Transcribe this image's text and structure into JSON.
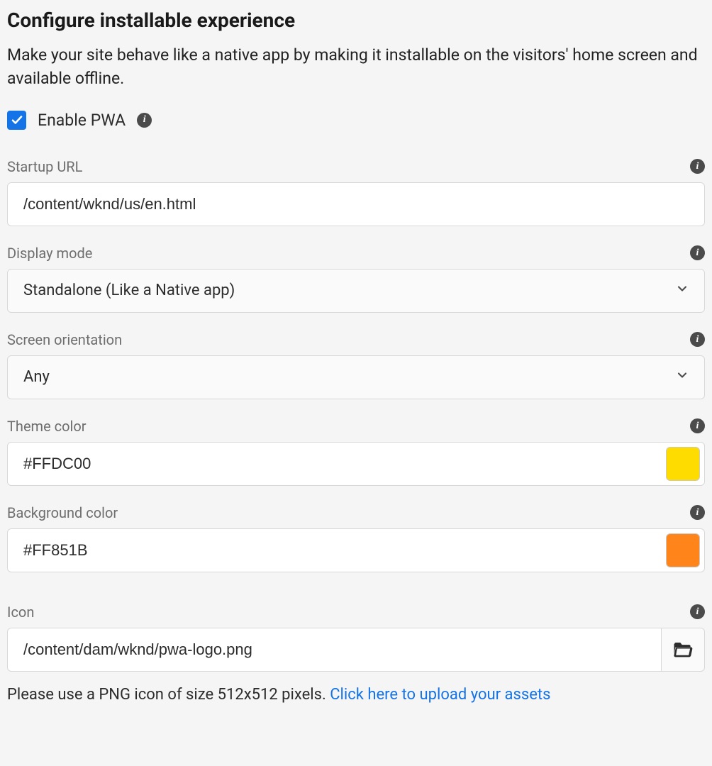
{
  "header": {
    "title": "Configure installable experience",
    "description": "Make your site behave like a native app by making it installable on the visitors' home screen and available offline."
  },
  "enable": {
    "checked": true,
    "label": "Enable PWA"
  },
  "fields": {
    "startup_url": {
      "label": "Startup URL",
      "value": "/content/wknd/us/en.html"
    },
    "display_mode": {
      "label": "Display mode",
      "value": "Standalone (Like a Native app)"
    },
    "screen_orientation": {
      "label": "Screen orientation",
      "value": "Any"
    },
    "theme_color": {
      "label": "Theme color",
      "value": "#FFDC00",
      "swatch": "#FFDC00"
    },
    "background_color": {
      "label": "Background color",
      "value": "#FF851B",
      "swatch": "#FF851B"
    },
    "icon": {
      "label": "Icon",
      "value": "/content/dam/wknd/pwa-logo.png",
      "hint_text": "Please use a PNG icon of size 512x512 pixels. ",
      "hint_link": "Click here to upload your assets"
    }
  }
}
